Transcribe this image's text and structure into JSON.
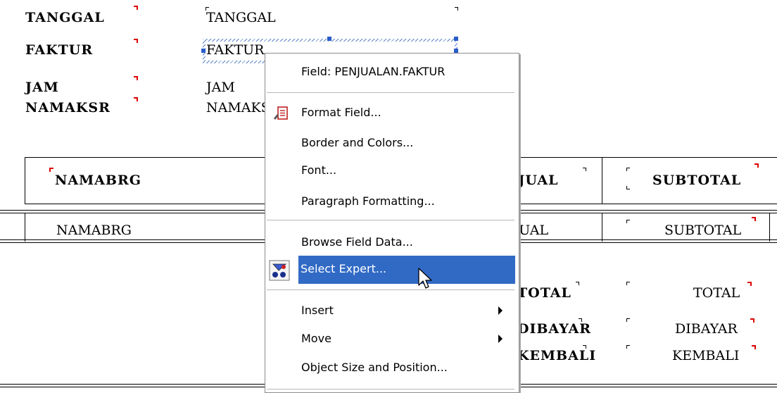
{
  "header": {
    "labels": [
      "TANGGAL",
      "FAKTUR",
      "JAM",
      "NAMAKSR"
    ],
    "fields": [
      "TANGGAL",
      "FAKTUR",
      "JAM",
      "NAMAKSR"
    ]
  },
  "details": {
    "columns": [
      "NAMABRG",
      "JMLJUAL",
      "SUBTOTAL"
    ],
    "row": [
      "NAMABRG",
      "JMLJUAL",
      "SUBTOTAL"
    ]
  },
  "footer": {
    "labels": [
      "TOTAL",
      "DIBAYAR",
      "KEMBALI"
    ],
    "fields": [
      "TOTAL",
      "DIBAYAR",
      "KEMBALI"
    ]
  },
  "context_menu": {
    "title": "Field: PENJUALAN.FAKTUR",
    "items": {
      "format_field": "Format Field...",
      "border_colors": "Border and Colors...",
      "font": "Font...",
      "paragraph": "Paragraph Formatting...",
      "browse": "Browse Field Data...",
      "select_expert": "Select Expert...",
      "insert": "Insert",
      "move": "Move",
      "size_position": "Object Size and Position..."
    },
    "highlight_color": "#316ac5"
  }
}
